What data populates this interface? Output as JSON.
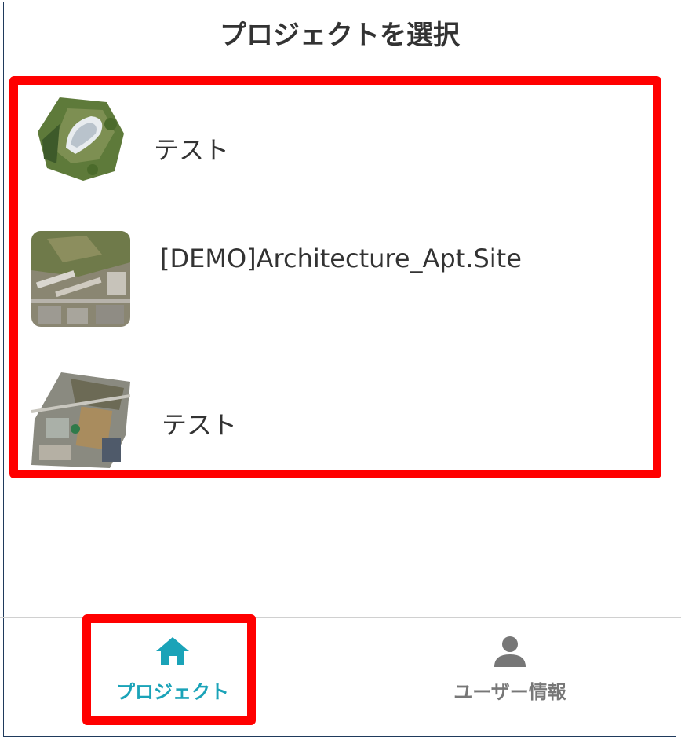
{
  "header": {
    "title": "プロジェクトを選択"
  },
  "projects": [
    {
      "name": "テスト",
      "thumbnail": "aerial-photo-stadium"
    },
    {
      "name": "[DEMO]Architecture_Apt.Site",
      "thumbnail": "aerial-photo-apartment-site"
    },
    {
      "name": "テスト",
      "thumbnail": "aerial-photo-construction-site"
    }
  ],
  "tabbar": {
    "tabs": [
      {
        "label": "プロジェクト",
        "icon": "home-icon",
        "active": true
      },
      {
        "label": "ユーザー情報",
        "icon": "user-icon",
        "active": false
      }
    ]
  },
  "colors": {
    "accent": "#1aa3b8",
    "inactive": "#777777",
    "highlight": "#ff0000"
  }
}
